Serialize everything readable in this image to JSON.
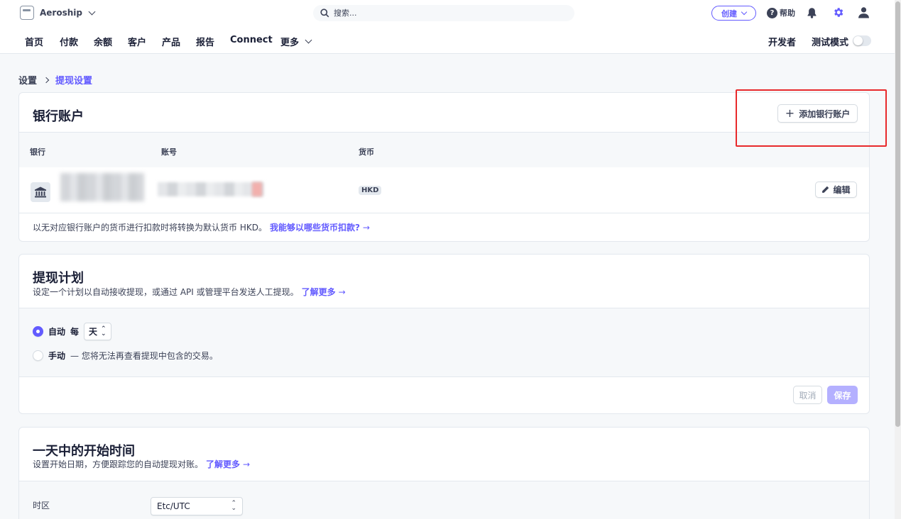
{
  "topbar": {
    "account_name": "Aeroship",
    "search_placeholder": "搜索...",
    "create_label": "创建",
    "help_label": "帮助"
  },
  "nav": {
    "items": [
      "首页",
      "付款",
      "余额",
      "客户",
      "产品",
      "报告",
      "Connect"
    ],
    "more_label": "更多",
    "developer_label": "开发者",
    "test_mode_label": "测试模式"
  },
  "breadcrumb": {
    "root": "设置",
    "current": "提现设置"
  },
  "bank_accounts": {
    "title": "银行账户",
    "add_button": "添加银行账户",
    "columns": [
      "银行",
      "账号",
      "货币"
    ],
    "rows": [
      {
        "currency": "HKD",
        "edit_label": "编辑"
      }
    ],
    "note": "以无对应银行账户的货币进行扣款时将转换为默认货币 HKD。",
    "note_link": "我能够以哪些货币扣款?"
  },
  "payout_schedule": {
    "title": "提现计划",
    "subtitle": "设定一个计划以自动接收提现，或通过 API 或管理平台发送人工提现。",
    "subtitle_link": "了解更多",
    "auto_label": "自动",
    "auto_every": "每",
    "interval_value": "天",
    "manual_label": "手动",
    "manual_desc": "— 您将无法再查看提现中包含的交易。",
    "cancel_label": "取消",
    "save_label": "保存"
  },
  "start_time": {
    "title": "一天中的开始时间",
    "subtitle": "设置开始日期，方便跟踪您的自动提现对账。",
    "subtitle_link": "了解更多",
    "timezone_label": "时区",
    "timezone_value": "Etc/UTC"
  },
  "colors": {
    "accent": "#635bff",
    "highlight": "#e8292b"
  }
}
